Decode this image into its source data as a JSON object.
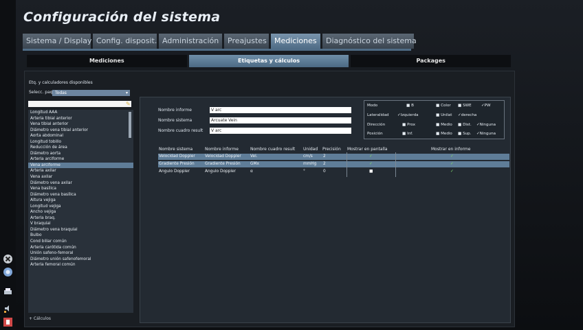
{
  "header": {
    "title": "Configuración del sistema"
  },
  "tabs": [
    {
      "label": "Sistema / Display",
      "active": false
    },
    {
      "label": "Config. disposit.",
      "active": false
    },
    {
      "label": "Administración",
      "active": false
    },
    {
      "label": "Preajustes",
      "active": false
    },
    {
      "label": "Mediciones",
      "active": true
    },
    {
      "label": "Diagnóstico del sistema",
      "active": false
    }
  ],
  "subtabs": [
    {
      "label": "Mediciones",
      "active": false
    },
    {
      "label": "Etiquetas y cálculos",
      "active": true
    },
    {
      "label": "Packages",
      "active": false
    }
  ],
  "left": {
    "section_title": "Etq. y calculadores disponibles",
    "package_label": "Selecc. paquete",
    "package_value": "Todas",
    "items": [
      "Longitud AAA",
      "Arteria tibial anterior",
      "Vena tibial anterior",
      "Diámetro vena tibial anterior",
      "Aorta abdominal",
      "Longitud tobillo",
      "Reducción de área",
      "Diámetro aorta",
      "Arteria arciforme",
      "Vena arciforme",
      "Arteria axilar",
      "Vena axilar",
      "Diámetro vena axilar",
      "Vena basílica",
      "Diámetro vena basílica",
      "Altura vejiga",
      "Longitud vejiga",
      "Ancho vejiga",
      "Arteria braq.",
      "V braquial",
      "Diámetro vena braquial",
      "Bulbo",
      "Cond biliar común",
      "Arteria carótida común",
      "Unión safeno-femoral",
      "Diámetro unión safenofemoral",
      "Arteria femoral común"
    ],
    "selected_index": 9,
    "calc_label": "+ Cálculos"
  },
  "form": {
    "report_name_label": "Nombre informe",
    "report_name_value": "V arc",
    "system_name_label": "Nombre sistema",
    "system_name_value": "Arcuate Vein",
    "result_name_label": "Nombre cuadro result",
    "result_name_value": "V arc"
  },
  "properties": {
    "mode_label": "Modo",
    "mode_b": "■ B",
    "mode_color": "■ Color",
    "mode_swe": "■ SWE",
    "mode_pw": "✓PW",
    "lat_label": "Lateralidad",
    "lat_izq": "✓Izquierda",
    "lat_unilat": "■ Unilat",
    "lat_der": "✓derecha",
    "dir_label": "Dirección",
    "dir_prox": "■ Prox",
    "dir_medio": "■ Medio",
    "dir_dist": "■ Dist.",
    "dir_ninguna": "✓Ninguna",
    "pos_label": "Posición",
    "pos_inf": "■ Inf.",
    "pos_medio": "■ Medio",
    "pos_sup": "■ Sup.",
    "pos_ninguna": "✓Ninguna"
  },
  "table": {
    "headers": [
      "Nombre sistema",
      "Nombre informe",
      "Nombre cuadro result",
      "Unidad",
      "Precisión",
      "Mostrar en pantalla",
      "Mostrar en informe"
    ],
    "rows": [
      {
        "system": "Velocidad Doppler",
        "report": "Velocidad Doppler",
        "result": "Vel.",
        "unit": "cm/s",
        "precision": "2",
        "screen": "✓",
        "report_show": "✓",
        "selected": true
      },
      {
        "system": "Gradiente Presión",
        "report": "Gradiente Presión",
        "result": "GMx",
        "unit": "mmHg",
        "precision": "2",
        "screen": "✓",
        "report_show": "✓",
        "selected": true
      },
      {
        "system": "Angulo Doppler",
        "report": "Angulo Doppler",
        "result": "α",
        "unit": "°",
        "precision": "0",
        "screen": "■",
        "report_show": "✓",
        "selected": false
      }
    ]
  },
  "colors": {
    "accent": "#5f7d98",
    "check": "#7dd36c"
  }
}
